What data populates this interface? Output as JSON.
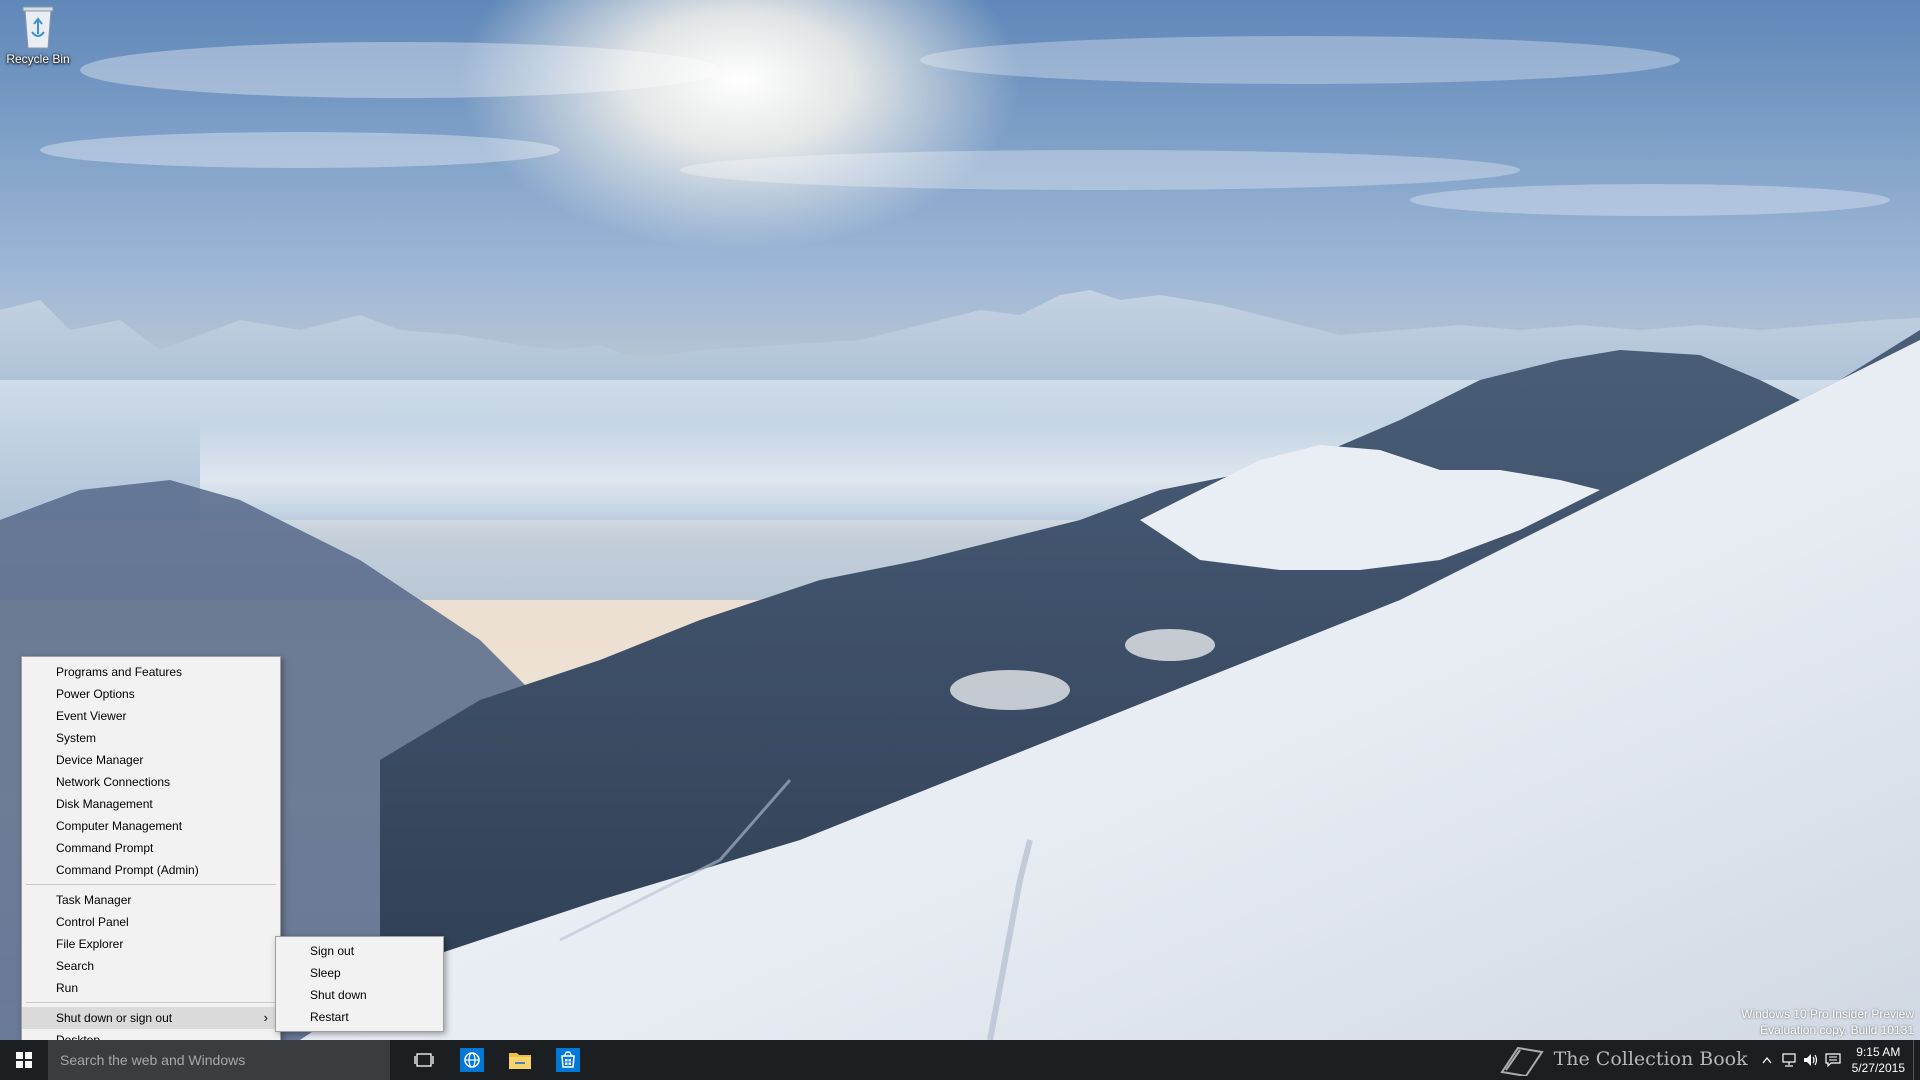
{
  "desktop": {
    "icons": [
      {
        "label": "Recycle Bin",
        "icon": "recycle-bin-icon"
      }
    ]
  },
  "winx_menu": {
    "group1": [
      "Programs and Features",
      "Power Options",
      "Event Viewer",
      "System",
      "Device Manager",
      "Network Connections",
      "Disk Management",
      "Computer Management",
      "Command Prompt",
      "Command Prompt (Admin)"
    ],
    "group2": [
      "Task Manager",
      "Control Panel",
      "File Explorer",
      "Search",
      "Run"
    ],
    "shutdown": {
      "label": "Shut down or sign out",
      "arrow": "›"
    },
    "desktop": {
      "label": "Desktop"
    }
  },
  "submenu": {
    "items": [
      "Sign out",
      "Sleep",
      "Shut down",
      "Restart"
    ]
  },
  "watermark": {
    "line1": "Windows 10 Pro Insider Preview",
    "line2": "Evaluation copy. Build 10131"
  },
  "taskbar": {
    "search_placeholder": "Search the web and Windows",
    "pinned": [
      "task-view-icon",
      "edge-browser-icon",
      "file-explorer-icon",
      "store-icon"
    ],
    "tray_icons": [
      "show-hidden-icons-icon",
      "network-icon",
      "volume-icon",
      "action-center-icon"
    ],
    "clock_time": "9:15 AM",
    "clock_date": "5/27/2015",
    "overlay_text": "The Collection Book"
  },
  "colors": {
    "taskbar": "#1c1f22",
    "search_box": "#3a3d40",
    "menu_bg": "#f2f2f2",
    "menu_hover": "#dadada",
    "windows_blue": "#0078d7"
  }
}
